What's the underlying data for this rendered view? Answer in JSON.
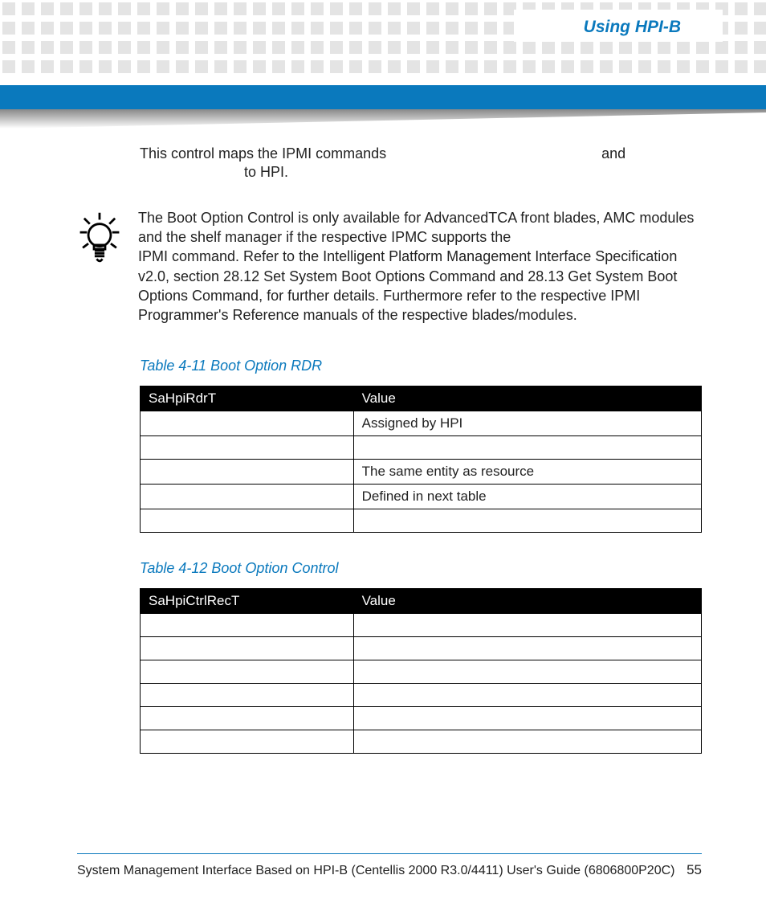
{
  "header": {
    "title": "Using HPI-B"
  },
  "paragraph1": {
    "prefix": "This control maps the IPMI commands",
    "mid": "and",
    "suffix": "to HPI."
  },
  "tip": {
    "text_a": "The Boot Option Control is only available for AdvancedTCA front blades, AMC modules and the shelf manager if the respective IPMC supports the",
    "text_b": "IPMI command. Refer to the Intelligent Platform Management Interface Specification v2.0, section 28.12 Set System Boot Options Command and 28.13 Get System Boot Options Command, for further details. Furthermore refer to the respective IPMI Programmer's Reference manuals of the respective blades/modules."
  },
  "table1": {
    "caption": "Table 4-11 Boot Option RDR",
    "col1": "SaHpiRdrT",
    "col2": "Value",
    "rows": [
      {
        "c1": "",
        "c2": "Assigned by HPI"
      },
      {
        "c1": "",
        "c2": ""
      },
      {
        "c1": "",
        "c2": "The same entity as resource"
      },
      {
        "c1": "",
        "c2": "Defined in next table"
      },
      {
        "c1": "",
        "c2": ""
      }
    ]
  },
  "table2": {
    "caption": "Table 4-12 Boot Option Control",
    "col1": "SaHpiCtrlRecT",
    "col2": "Value",
    "rows": [
      {
        "c1": "",
        "c2": ""
      },
      {
        "c1": "",
        "c2": ""
      },
      {
        "c1": "",
        "c2": ""
      },
      {
        "c1": "",
        "c2": ""
      },
      {
        "c1": "",
        "c2": ""
      },
      {
        "c1": "",
        "c2": ""
      }
    ]
  },
  "footer": {
    "text": "System Management Interface Based on HPI-B (Centellis 2000 R3.0/4411) User's Guide (6806800P20C)",
    "page": "55"
  }
}
